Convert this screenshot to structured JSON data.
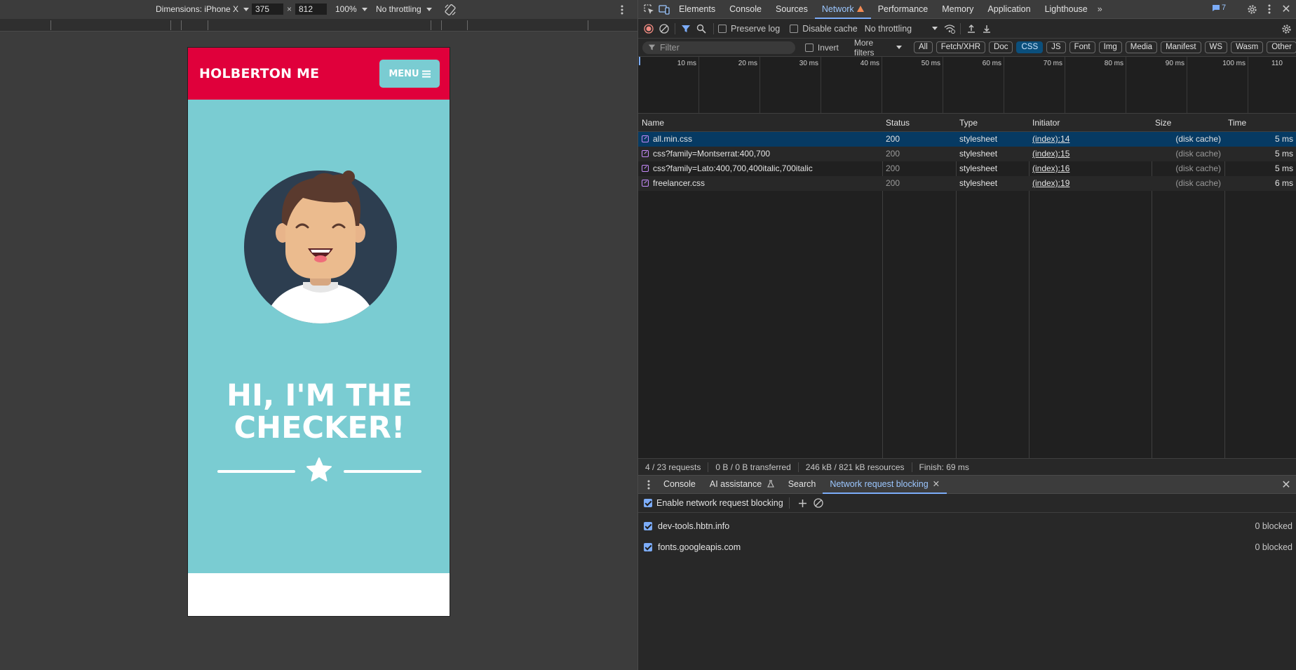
{
  "emulation": {
    "dimensions_label": "Dimensions: iPhone X",
    "width": "375",
    "times": "×",
    "height": "812",
    "zoom": "100%",
    "throttling": "No throttling"
  },
  "phone_page": {
    "brand": "HOLBERTON ME",
    "menu_label": "MENU",
    "title_line1": "HI, I'M THE",
    "title_line2": "CHECKER!",
    "colors": {
      "nav": "#e0003b",
      "hero": "#7accd2"
    }
  },
  "devtools": {
    "tabs": [
      "Elements",
      "Console",
      "Sources",
      "Network",
      "Performance",
      "Memory",
      "Application",
      "Lighthouse"
    ],
    "active_tab": "Network",
    "issues_count": "7",
    "toolbar": {
      "preserve_log": "Preserve log",
      "disable_cache": "Disable cache",
      "throttling": "No throttling"
    },
    "filter": {
      "placeholder": "Filter",
      "invert": "Invert",
      "more_filters": "More filters",
      "chips": [
        "All",
        "Fetch/XHR",
        "Doc",
        "CSS",
        "JS",
        "Font",
        "Img",
        "Media",
        "Manifest",
        "WS",
        "Wasm",
        "Other"
      ],
      "active_chip": "CSS"
    },
    "overview_ticks": [
      "10 ms",
      "20 ms",
      "30 ms",
      "40 ms",
      "50 ms",
      "60 ms",
      "70 ms",
      "80 ms",
      "90 ms",
      "100 ms",
      "110"
    ],
    "columns": [
      "Name",
      "Status",
      "Type",
      "Initiator",
      "Size",
      "Time"
    ],
    "requests": [
      {
        "name": "all.min.css",
        "status": "200",
        "type": "stylesheet",
        "initiator": "(index):14",
        "size": "(disk cache)",
        "time": "5 ms"
      },
      {
        "name": "css?family=Montserrat:400,700",
        "status": "200",
        "type": "stylesheet",
        "initiator": "(index):15",
        "size": "(disk cache)",
        "time": "5 ms"
      },
      {
        "name": "css?family=Lato:400,700,400italic,700italic",
        "status": "200",
        "type": "stylesheet",
        "initiator": "(index):16",
        "size": "(disk cache)",
        "time": "5 ms"
      },
      {
        "name": "freelancer.css",
        "status": "200",
        "type": "stylesheet",
        "initiator": "(index):19",
        "size": "(disk cache)",
        "time": "6 ms"
      }
    ],
    "summary": {
      "requests": "4 / 23 requests",
      "transferred": "0 B / 0 B transferred",
      "resources": "246 kB / 821 kB resources",
      "finish": "Finish: 69 ms"
    },
    "drawer": {
      "tabs": [
        "Console",
        "AI assistance",
        "Search",
        "Network request blocking"
      ],
      "active_tab": "Network request blocking",
      "enable_label": "Enable network request blocking",
      "patterns": [
        {
          "pattern": "dev-tools.hbtn.info",
          "count": "0 blocked"
        },
        {
          "pattern": "fonts.googleapis.com",
          "count": "0 blocked"
        }
      ]
    }
  }
}
